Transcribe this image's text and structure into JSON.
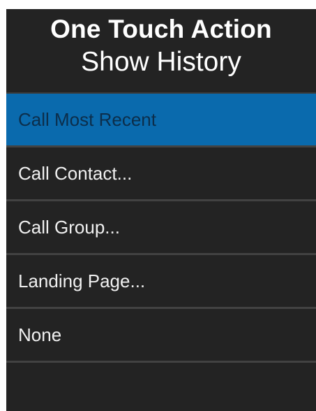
{
  "header": {
    "title": "One Touch Action",
    "subtitle": "Show History"
  },
  "menu": {
    "selected_index": 0,
    "items": [
      {
        "label": "Call Most Recent"
      },
      {
        "label": "Call Contact..."
      },
      {
        "label": "Call Group..."
      },
      {
        "label": "Landing Page..."
      },
      {
        "label": "None"
      }
    ]
  },
  "colors": {
    "background": "#232323",
    "selected_background": "#0a6aad",
    "selected_text": "#0c2e4b",
    "text": "#f0f0f0",
    "separator": "#424242"
  }
}
